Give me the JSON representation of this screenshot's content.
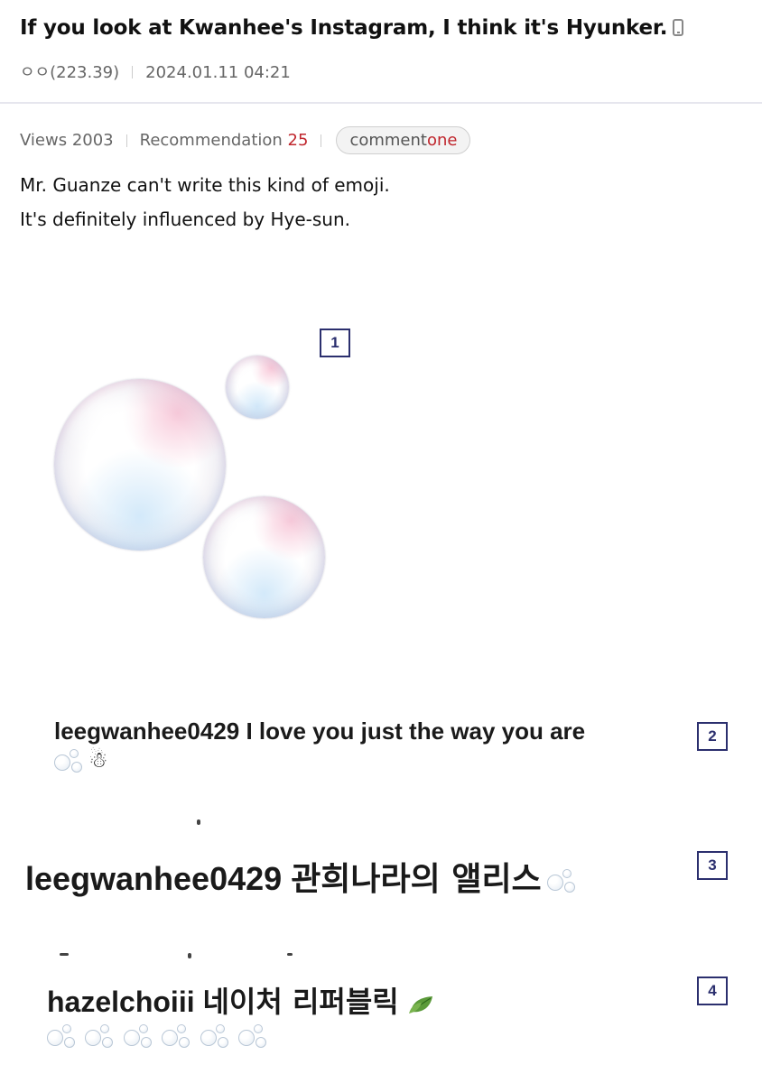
{
  "post": {
    "title": "If you look at Kwanhee's Instagram, I think it's Hyunker.",
    "author": "ㅇㅇ(223.39)",
    "datetime": "2024.01.11 04:21",
    "views_label": "Views 2003",
    "recommend_label": "Recommendation",
    "recommend_count": "25",
    "comment_label": "comment",
    "comment_count": "one",
    "body_lines": [
      "Mr. Guanze can't write this kind of emoji.",
      "It's definitely influenced by Hye-sun."
    ]
  },
  "figures": [
    {
      "number": "1"
    },
    {
      "number": "2",
      "user": "leegwanhee0429",
      "text": "I love you just the way you are"
    },
    {
      "number": "3",
      "user": "leegwanhee0429",
      "text": "관희나라의 앨리스"
    },
    {
      "number": "4",
      "user": "hazelchoiii",
      "text": "네이처 리퍼블릭"
    }
  ],
  "icons": {
    "phone": "mobile-phone-icon",
    "bubbles": "bubbles-emoji",
    "snowman": "snowman-emoji",
    "leaf": "leaf-emoji"
  },
  "colors": {
    "accent_red": "#c0262d",
    "box_navy": "#2b2f6e"
  }
}
